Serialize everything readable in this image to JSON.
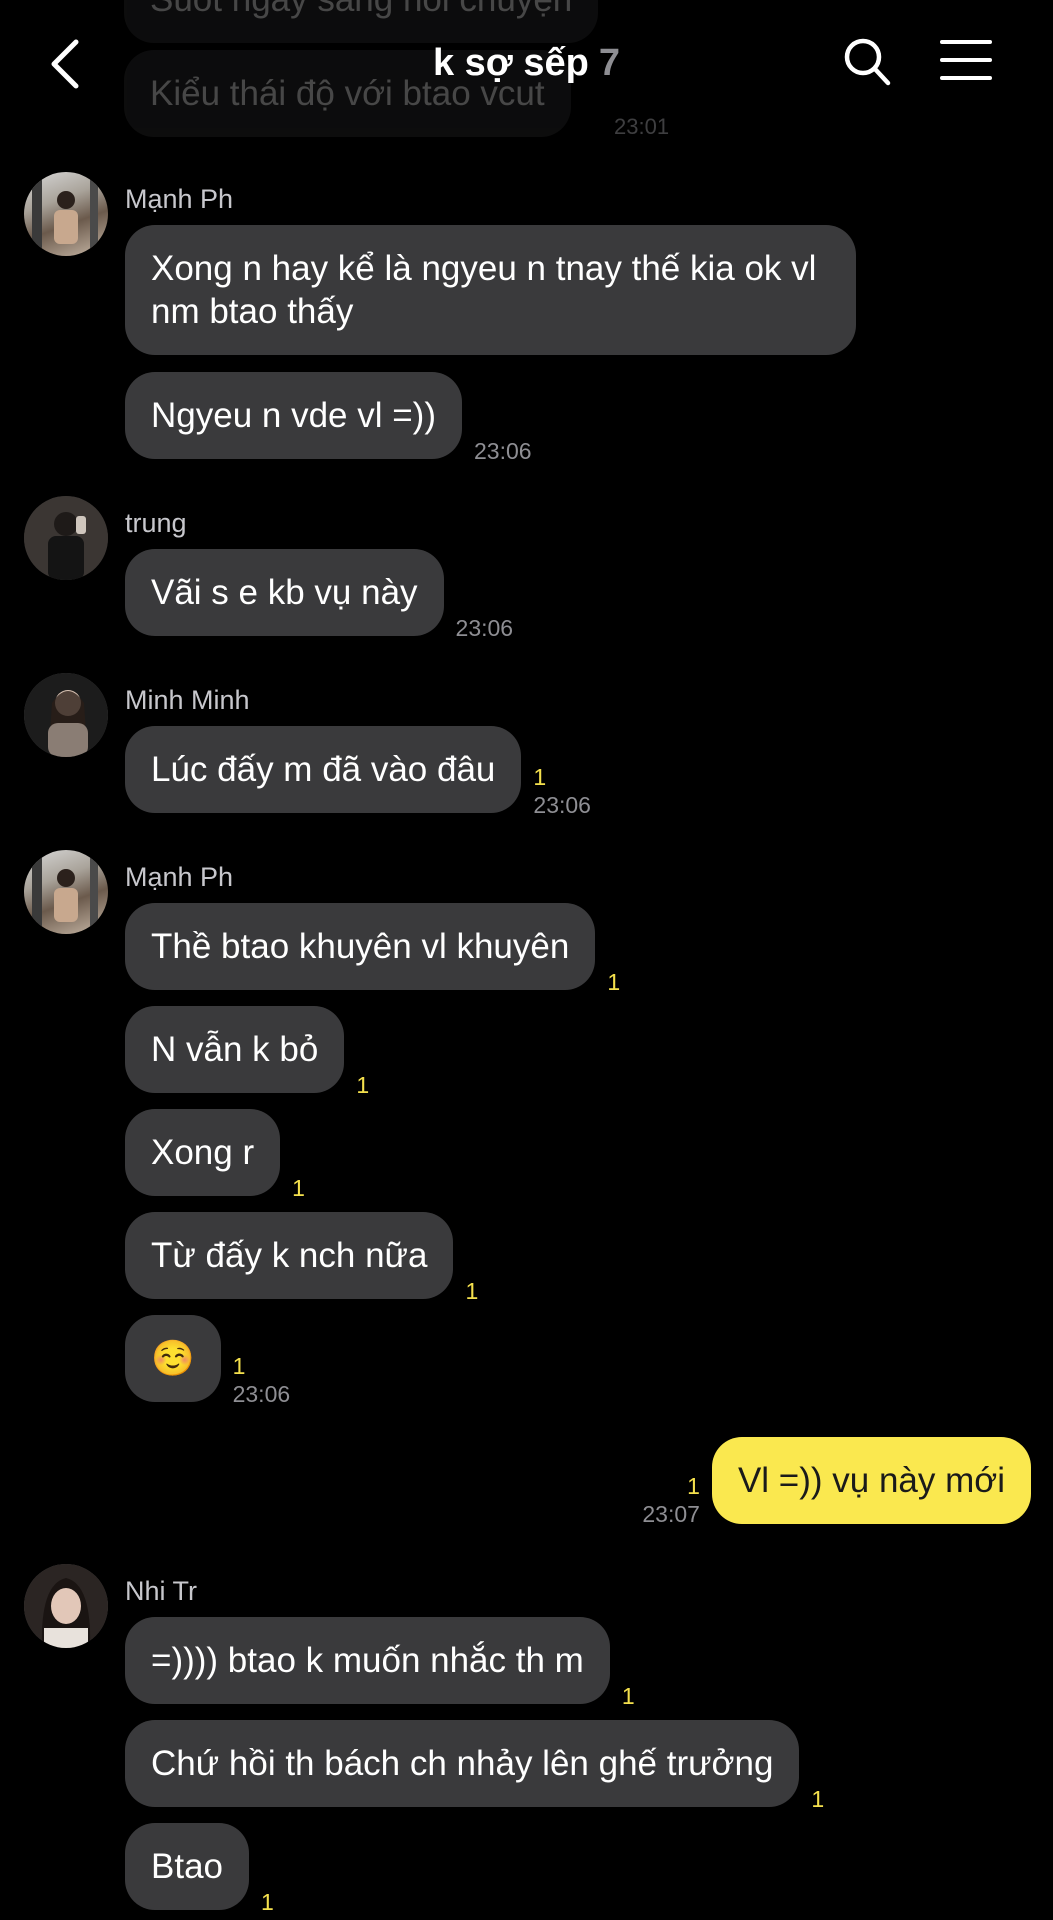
{
  "header": {
    "title": "k sợ sếp",
    "member_count": "7"
  },
  "faded_top": {
    "message_1": "Suốt ngày sang nói chuyện",
    "message_2": "Kiểu thái độ với btao vcut",
    "time": "23:01"
  },
  "groups": [
    {
      "sender": "Mạnh Ph",
      "messages": [
        {
          "text": "Xong n hay kể là ngyeu n tnay thế kia ok vl nm btao thấy",
          "unread": "",
          "time": ""
        },
        {
          "text": "Ngyeu n vde vl =))",
          "unread": "",
          "time": "23:06"
        }
      ]
    },
    {
      "sender": "trung",
      "messages": [
        {
          "text": "Vãi s e kb vụ này",
          "unread": "",
          "time": "23:06"
        }
      ]
    },
    {
      "sender": "Minh Minh",
      "messages": [
        {
          "text": "Lúc đấy m đã vào đâu",
          "unread": "1",
          "time": "23:06"
        }
      ]
    },
    {
      "sender": "Mạnh Ph",
      "messages": [
        {
          "text": "Thề btao khuyên vl khuyên",
          "unread": "1",
          "time": ""
        },
        {
          "text": "N vẫn k bỏ",
          "unread": "1",
          "time": ""
        },
        {
          "text": "Xong r",
          "unread": "1",
          "time": ""
        },
        {
          "text": "Từ đấy k nch nữa",
          "unread": "1",
          "time": ""
        },
        {
          "text": "☺️",
          "unread": "1",
          "time": "23:06"
        }
      ]
    },
    {
      "mine": true,
      "messages": [
        {
          "text": "Vl =)) vụ này mới",
          "unread": "1",
          "time": "23:07"
        }
      ]
    },
    {
      "sender": "Nhi Tr",
      "messages": [
        {
          "text": "=)))) btao k muốn nhắc th m",
          "unread": "1",
          "time": ""
        },
        {
          "text": "Chứ hồi th bách ch nhảy lên ghế trưởng",
          "unread": "1",
          "time": ""
        },
        {
          "text": "Btao",
          "unread": "1",
          "time": ""
        }
      ]
    }
  ],
  "colors": {
    "background": "#000000",
    "bubble_other": "#3a3a3c",
    "bubble_mine": "#fae84f",
    "unread": "#f4e04d",
    "timestamp": "#8e8e93"
  },
  "icons": [
    "back-icon",
    "search-icon",
    "menu-icon"
  ]
}
